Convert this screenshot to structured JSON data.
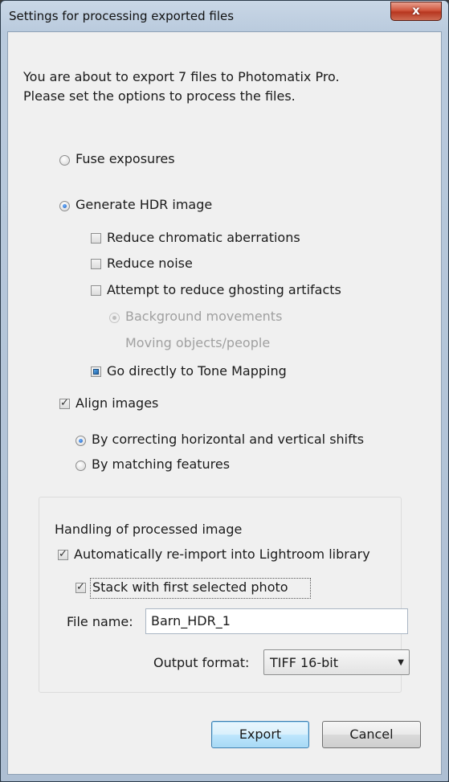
{
  "window": {
    "title": "Settings for processing exported files",
    "close_glyph": "x"
  },
  "intro": {
    "line1": "You are about to export 7 files to Photomatix Pro.",
    "line2": "Please set the options to process the files."
  },
  "mode": {
    "fuse": {
      "label": "Fuse exposures",
      "selected": false
    },
    "hdr": {
      "label": "Generate HDR image",
      "selected": true
    }
  },
  "hdr_options": {
    "chromatic": {
      "label": "Reduce chromatic aberrations",
      "checked": false
    },
    "noise": {
      "label": "Reduce noise",
      "checked": false
    },
    "ghosting": {
      "label": "Attempt to reduce ghosting artifacts",
      "checked": false
    },
    "ghost_background": {
      "label": "Background movements",
      "selected": true,
      "enabled": false
    },
    "ghost_moving": {
      "label": "Moving objects/people",
      "selected": false,
      "enabled": false
    },
    "tone_mapping": {
      "label": "Go directly to Tone Mapping",
      "state": "indeterminate"
    }
  },
  "align": {
    "label": "Align images",
    "checked": true,
    "shifts": {
      "label": "By correcting horizontal and vertical shifts",
      "selected": true
    },
    "features": {
      "label": "By matching features",
      "selected": false
    }
  },
  "handling": {
    "heading": "Handling of processed image",
    "reimport": {
      "label": "Automatically re-import into Lightroom library",
      "checked": true
    },
    "stack": {
      "label": "Stack with first selected photo",
      "checked": true
    },
    "file_name_label": "File name:",
    "file_name_value": "Barn_HDR_1",
    "output_format_label": "Output format:",
    "output_format_value": "TIFF 16-bit"
  },
  "buttons": {
    "export": "Export",
    "cancel": "Cancel"
  }
}
